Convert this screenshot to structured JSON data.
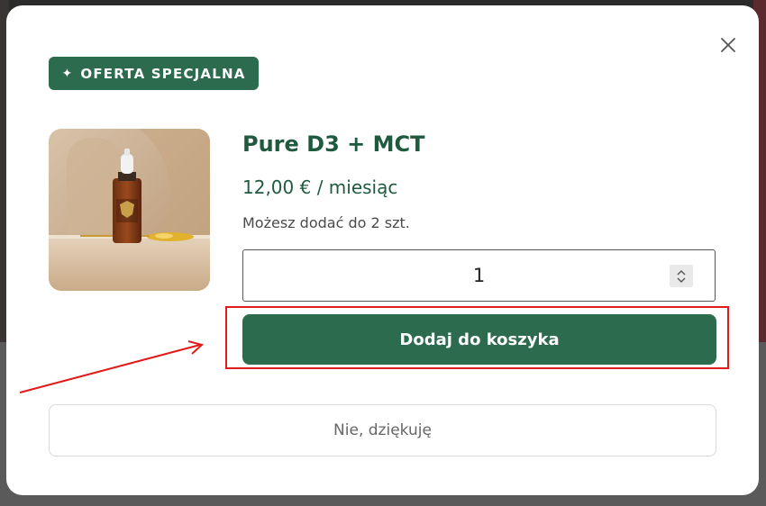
{
  "modal": {
    "badge": {
      "icon": "diamond-icon",
      "label": "OFERTA SPECJALNA"
    },
    "product": {
      "name": "Pure D3 + MCT",
      "price": "12,00 € / miesiąc",
      "limit_text": "Możesz dodać do 2 szt.",
      "image": "product-bottle-image"
    },
    "quantity": {
      "value": "1"
    },
    "add_to_cart_label": "Dodaj do koszyka",
    "decline_label": "Nie, dziękuję",
    "close_icon": "close-icon"
  },
  "annotation": {
    "color": "#e11b1b"
  },
  "colors": {
    "brand_green": "#2d6b4e",
    "text_green": "#1f5a3e"
  }
}
